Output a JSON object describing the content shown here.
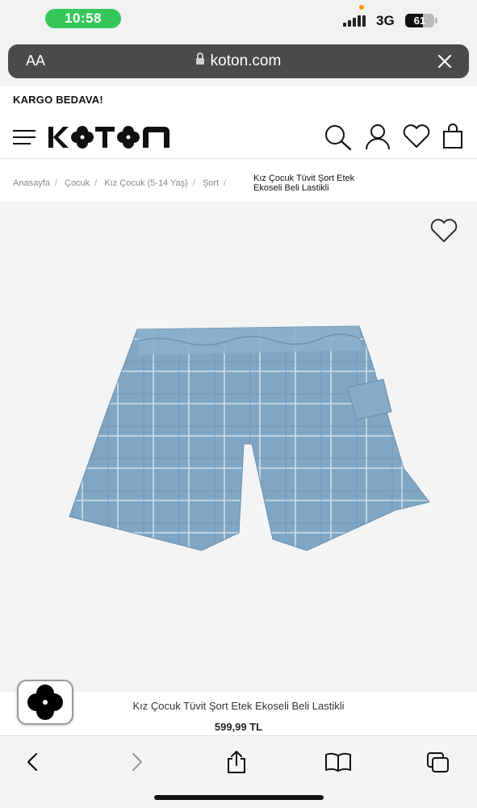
{
  "status_bar": {
    "time": "10:58",
    "network": "3G",
    "battery": "61",
    "battery_level": 0.61,
    "colors": {
      "time_pill": "#35c759",
      "indicator_dot": "#ff9500"
    }
  },
  "browser": {
    "text_size_label": "AA",
    "url": "koton.com",
    "icons": [
      "lock-icon",
      "close-icon"
    ]
  },
  "promo": {
    "text": "KARGO BEDAVA!"
  },
  "header": {
    "logo_text": "KOTON",
    "icons": [
      "menu-icon",
      "search-icon",
      "account-icon",
      "favorites-icon",
      "cart-icon"
    ]
  },
  "breadcrumb": {
    "items": [
      "Anasayfa",
      "Çocuk",
      "Kız Çocuk (5-14 Yaş)",
      "Şort"
    ],
    "separator": "/",
    "current": "Kız Çocuk Tüvit Şort Etek Ekoseli Beli Lastikli"
  },
  "product": {
    "name": "Kız Çocuk Tüvit Şort Etek Ekoseli Beli Lastikli",
    "price": "599,99 TL",
    "image_description_color": "#7fa6c4"
  },
  "toolbar": {
    "icons": [
      "back-icon",
      "forward-icon",
      "share-icon",
      "bookmarks-icon",
      "tabs-icon"
    ]
  }
}
